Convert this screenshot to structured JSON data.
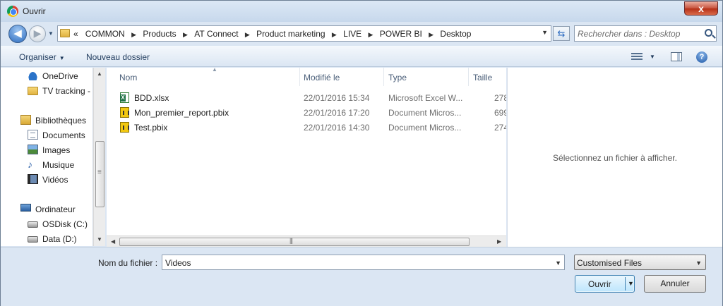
{
  "window": {
    "title": "Ouvrir",
    "close_glyph": "x"
  },
  "navigation": {
    "back_glyph": "◀",
    "forward_glyph": "▶",
    "recent_glyph": "▼",
    "breadcrumb_lead": "«",
    "breadcrumbs": [
      "COMMON",
      "Products",
      "AT Connect",
      "Product marketing",
      "LIVE",
      "POWER BI",
      "Desktop"
    ],
    "address_dropdown_glyph": "▼",
    "refresh_glyph": "⇆",
    "search_placeholder": "Rechercher dans : Desktop"
  },
  "toolbar": {
    "organiser_label": "Organiser",
    "organiser_caret": "▼",
    "new_folder_label": "Nouveau dossier",
    "view_caret": "▼",
    "help_glyph": "?"
  },
  "nav_pane": {
    "items": [
      {
        "label": "OneDrive",
        "icon": "onedrive-cloud-icon"
      },
      {
        "label": "TV tracking -  ",
        "icon": "folder-icon"
      },
      {
        "label": "Bibliothèques",
        "icon": "libraries-icon"
      },
      {
        "label": "Documents",
        "icon": "documents-icon"
      },
      {
        "label": "Images",
        "icon": "images-icon"
      },
      {
        "label": "Musique",
        "icon": "music-icon"
      },
      {
        "label": "Vidéos",
        "icon": "videos-icon"
      },
      {
        "label": "Ordinateur",
        "icon": "computer-icon"
      },
      {
        "label": "OSDisk (C:)",
        "icon": "disk-icon"
      },
      {
        "label": "Data (D:)",
        "icon": "disk-icon"
      }
    ],
    "scroll_up_glyph": "▲",
    "scroll_down_glyph": "▼"
  },
  "file_list": {
    "columns": [
      "Nom",
      "Modifié le",
      "Type",
      "Taille"
    ],
    "sort_glyph": "▲",
    "rows": [
      {
        "name": "BDD.xlsx",
        "modified": "22/01/2016 15:34",
        "type": "Microsoft Excel W...",
        "size": "278",
        "icon": "excel-file-icon"
      },
      {
        "name": "Mon_premier_report.pbix",
        "modified": "22/01/2016 17:20",
        "type": "Document Micros...",
        "size": "699",
        "icon": "powerbi-file-icon"
      },
      {
        "name": "Test.pbix",
        "modified": "22/01/2016 14:30",
        "type": "Document Micros...",
        "size": "274",
        "icon": "powerbi-file-icon"
      }
    ],
    "hscroll_left_glyph": "◀",
    "hscroll_right_glyph": "▶"
  },
  "preview": {
    "message": "Sélectionnez un fichier à afficher."
  },
  "footer": {
    "filename_label": "Nom du fichier :",
    "filename_value": "Videos",
    "filename_dropdown_glyph": "▼",
    "filter_value": "Customised Files",
    "filter_dropdown_glyph": "▼",
    "open_label": "Ouvrir",
    "open_dropdown_glyph": "▼",
    "cancel_label": "Annuler"
  }
}
